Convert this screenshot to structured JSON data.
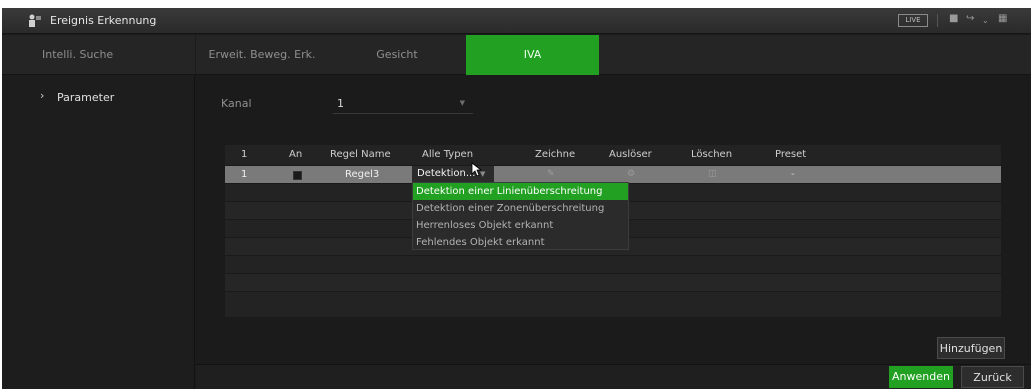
{
  "window": {
    "title": "Ereignis Erkennung",
    "live_label": "LIVE",
    "icons": [
      "person-icon",
      "logout-icon",
      "grid-icon"
    ]
  },
  "sidebar": {
    "top_label": "Intelli. Suche",
    "items": [
      {
        "label": "Parameter",
        "icon": "chevron-right-icon"
      }
    ]
  },
  "tabs": [
    {
      "label": "Erweit. Beweg. Erk.",
      "active": false
    },
    {
      "label": "Gesicht",
      "active": false
    },
    {
      "label": "IVA",
      "active": true
    }
  ],
  "kanal": {
    "label": "Kanal",
    "value": "1"
  },
  "table": {
    "headers": {
      "index": "1",
      "on": "An",
      "rule_name": "Regel Name",
      "all_types": "Alle Typen",
      "draw": "Zeichne",
      "trigger": "Auslöser",
      "delete": "Löschen",
      "preset": "Preset"
    },
    "rows": [
      {
        "index": "1",
        "rule_name": "Regel3",
        "type": "Detektion...",
        "preset": "-"
      }
    ]
  },
  "type_dropdown": {
    "options": [
      {
        "label": "Detektion einer Linienüberschreitung",
        "selected": true
      },
      {
        "label": "Detektion einer Zonenüberschreitung",
        "selected": false
      },
      {
        "label": "Herrenloses Objekt erkannt",
        "selected": false
      },
      {
        "label": "Fehlendes Objekt erkannt",
        "selected": false
      }
    ]
  },
  "buttons": {
    "add": "Hinzufügen",
    "apply": "Anwenden",
    "back": "Zurück"
  },
  "colors": {
    "accent_green": "#22a022",
    "background": "#1b1b1b",
    "selected_row": "#7a7a7a"
  }
}
